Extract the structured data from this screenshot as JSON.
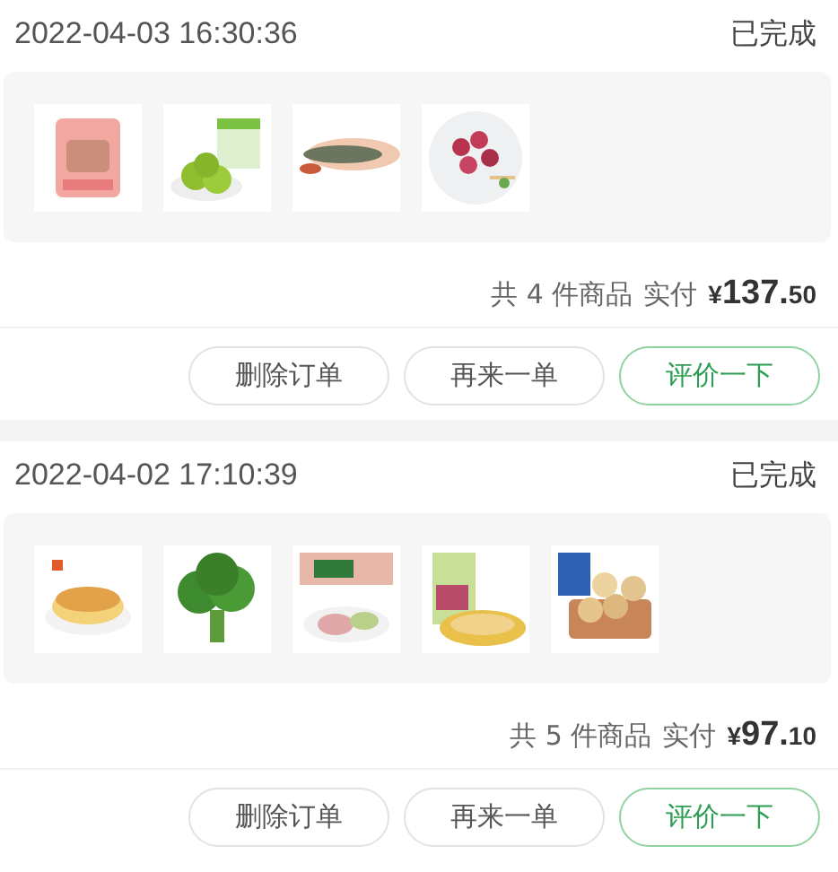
{
  "orders": [
    {
      "time": "2022-04-03 16:30:36",
      "status": "已完成",
      "products": [
        {
          "kind": "picture"
        },
        {
          "kind": "picture"
        },
        {
          "kind": "picture"
        },
        {
          "kind": "picture"
        }
      ],
      "count_text": "共 4 件商品",
      "paid_label": "实付",
      "currency": "¥",
      "price_main": "137.",
      "price_cents": "50",
      "buttons": [
        {
          "label": "删除订单",
          "kind": "plain"
        },
        {
          "label": "再来一单",
          "kind": "plain"
        },
        {
          "label": "评价一下",
          "kind": "primary"
        }
      ]
    },
    {
      "time": "2022-04-02 17:10:39",
      "status": "已完成",
      "products": [
        {
          "kind": "picture"
        },
        {
          "kind": "picture"
        },
        {
          "kind": "picture"
        },
        {
          "kind": "picture"
        },
        {
          "kind": "picture"
        }
      ],
      "count_text": "共 5 件商品",
      "paid_label": "实付",
      "currency": "¥",
      "price_main": "97.",
      "price_cents": "10",
      "buttons": [
        {
          "label": "删除订单",
          "kind": "plain"
        },
        {
          "label": "再来一单",
          "kind": "plain"
        },
        {
          "label": "评价一下",
          "kind": "primary"
        }
      ]
    }
  ]
}
